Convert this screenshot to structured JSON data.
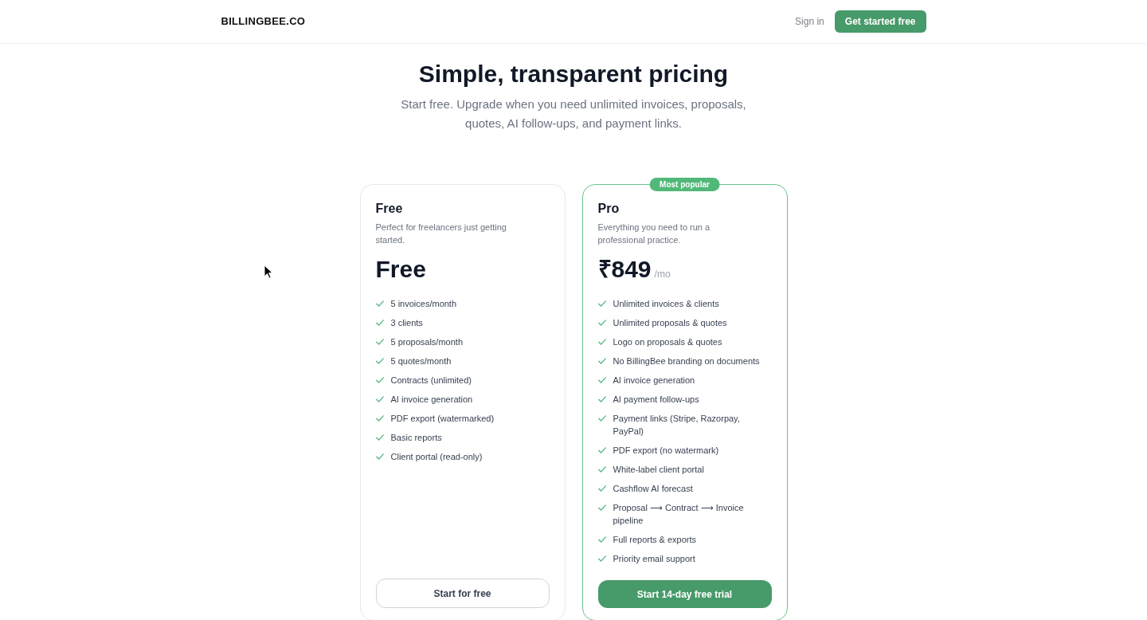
{
  "header": {
    "logo": "BILLINGBEE.CO",
    "actions": [
      {
        "kind": "link",
        "label": "Sign in"
      },
      {
        "kind": "button",
        "label": "Get started free"
      }
    ]
  },
  "hero": {
    "title": "Simple, transparent pricing",
    "subtitle": "Start free. Upgrade when you need unlimited invoices, proposals, quotes, AI follow-ups, and payment links."
  },
  "plans": [
    {
      "name": "Free",
      "featured": false,
      "description": "Perfect for freelancers just getting started.",
      "price": "Free",
      "features": [
        "5 invoices/month",
        "3 clients",
        "5 proposals/month",
        "5 quotes/month",
        "Contracts (unlimited)",
        "AI invoice generation",
        "PDF export (watermarked)",
        "Basic reports",
        "Client portal (read-only)"
      ],
      "cta": "Start for free"
    },
    {
      "name": "Pro",
      "featured": true,
      "badge": "Most popular",
      "description": "Everything you need to run a professional practice.",
      "price": "₹849",
      "period": "/mo",
      "features": [
        "Unlimited invoices & clients",
        "Unlimited proposals & quotes",
        "Logo on proposals & quotes",
        "No BillingBee branding on documents",
        "AI invoice generation",
        "AI payment follow-ups",
        "Payment links (Stripe, Razorpay, PayPal)",
        "PDF export (no watermark)",
        "White-label client portal",
        "Cashflow AI forecast",
        "Proposal ⟶ Contract ⟶ Invoice pipeline",
        "Full reports & exports",
        "Priority email support"
      ],
      "cta": "Start 14-day free trial"
    }
  ]
}
